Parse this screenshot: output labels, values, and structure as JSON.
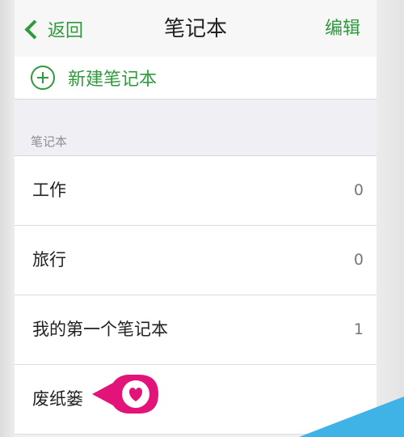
{
  "nav": {
    "back_label": "返回",
    "title": "笔记本",
    "edit_label": "编辑"
  },
  "new_notebook": {
    "label": "新建笔记本"
  },
  "section_header": "笔记本",
  "notebooks": [
    {
      "name": "工作",
      "count": "0"
    },
    {
      "name": "旅行",
      "count": "0"
    },
    {
      "name": "我的第一个笔记本",
      "count": "1"
    },
    {
      "name": "废纸篓",
      "count": ""
    }
  ],
  "colors": {
    "accent": "#2e9a3c",
    "pointer": "#e2147a",
    "corner": "#3fb3e6"
  }
}
